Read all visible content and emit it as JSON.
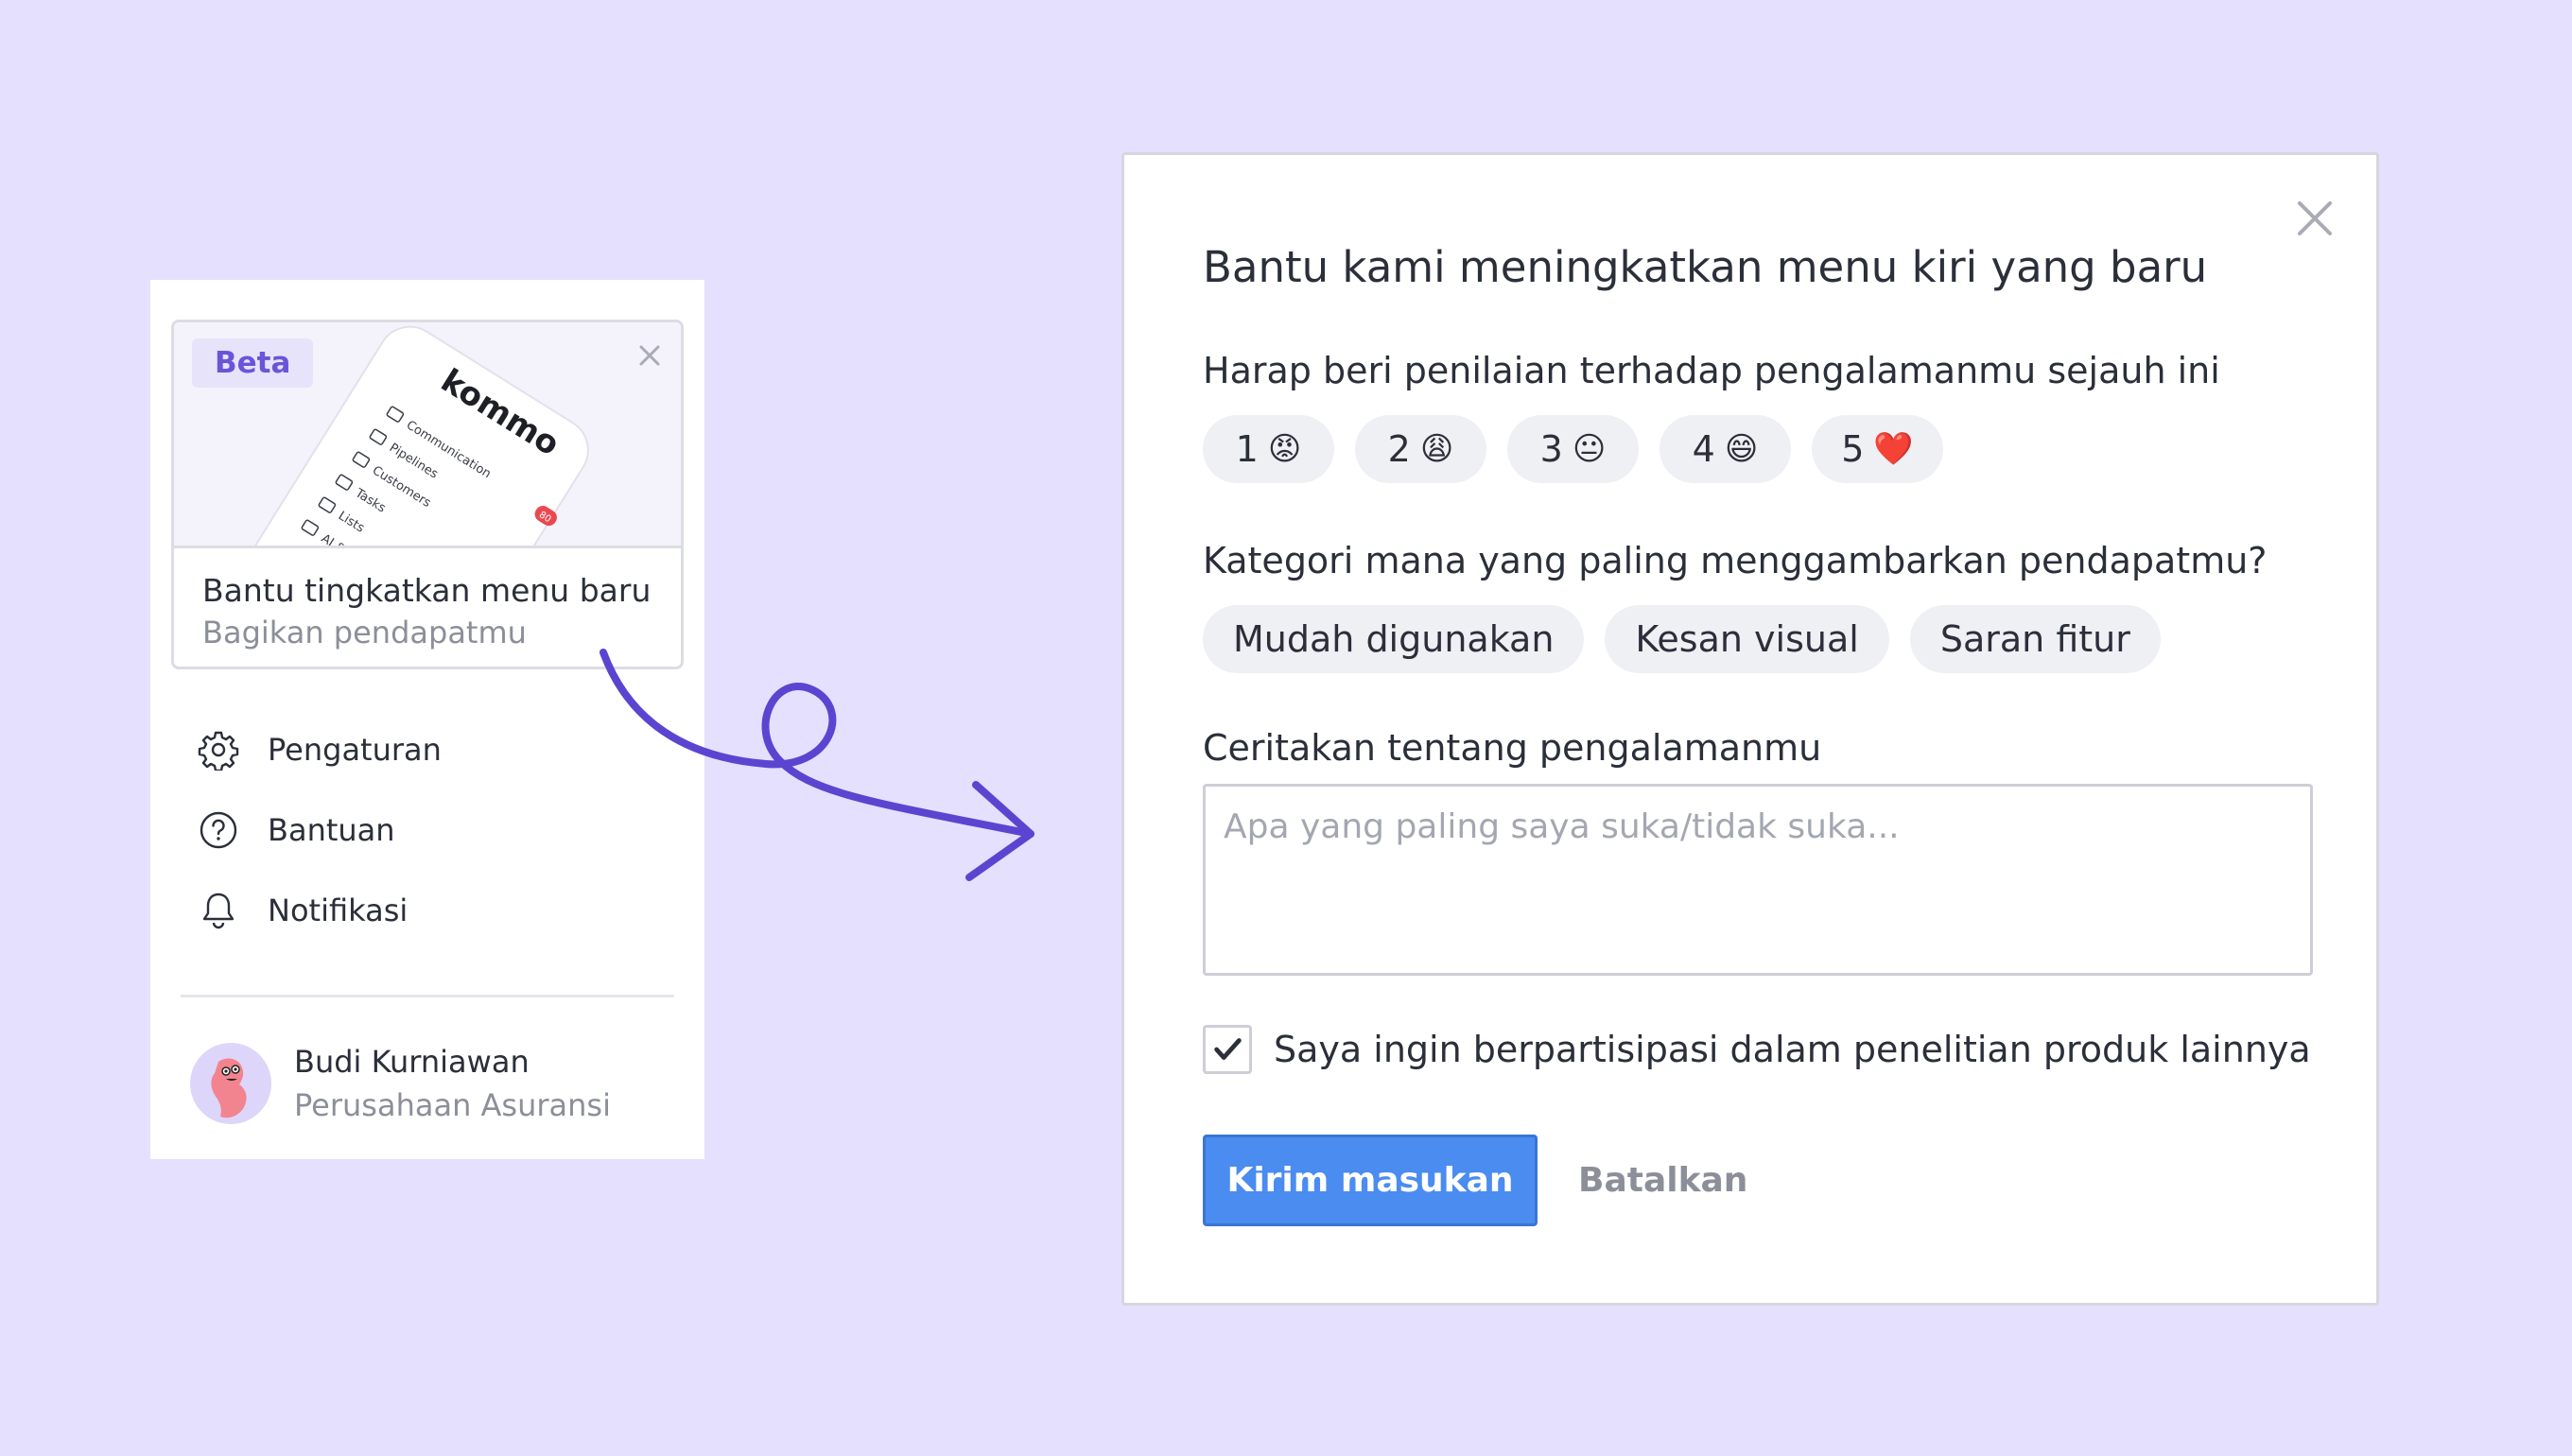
{
  "sidebar": {
    "beta_card": {
      "badge": "Beta",
      "preview": {
        "logo": "kommo",
        "items": [
          "Communication",
          "Pipelines",
          "Customers",
          "Tasks",
          "Lists",
          "AI &"
        ],
        "badge_count": "80"
      },
      "title": "Bantu tingkatkan menu baru",
      "subtitle": "Bagikan pendapatmu"
    },
    "nav": [
      {
        "label": "Pengaturan",
        "icon": "gear-icon"
      },
      {
        "label": "Bantuan",
        "icon": "help-icon"
      },
      {
        "label": "Notifikasi",
        "icon": "bell-icon"
      }
    ],
    "user": {
      "name": "Budi Kurniawan",
      "company": "Perusahaan Asuransi"
    }
  },
  "modal": {
    "title": "Bantu kami meningkatkan menu kiri yang baru",
    "rating_question": "Harap beri penilaian terhadap pengalamanmu sejauh ini",
    "ratings": [
      {
        "value": "1",
        "emoji": "😡"
      },
      {
        "value": "2",
        "emoji": "😩"
      },
      {
        "value": "3",
        "emoji": "😐"
      },
      {
        "value": "4",
        "emoji": "😄"
      },
      {
        "value": "5",
        "emoji": "❤️"
      }
    ],
    "category_question": "Kategori mana yang paling menggambarkan pendapatmu?",
    "categories": [
      "Mudah digunakan",
      "Kesan visual",
      "Saran fitur"
    ],
    "text_label": "Ceritakan tentang pengalamanmu",
    "text_value": "",
    "text_placeholder": "Apa yang paling saya suka/tidak suka...",
    "consent_checked": true,
    "consent_label": "Saya ingin berpartisipasi dalam penelitian produk lainnya",
    "submit_label": "Kirim masukan",
    "cancel_label": "Batalkan"
  },
  "colors": {
    "background": "#e4e0fd",
    "accent": "#6a55d8",
    "primary_button": "#4a8cf0",
    "arrow": "#5b45d0"
  }
}
